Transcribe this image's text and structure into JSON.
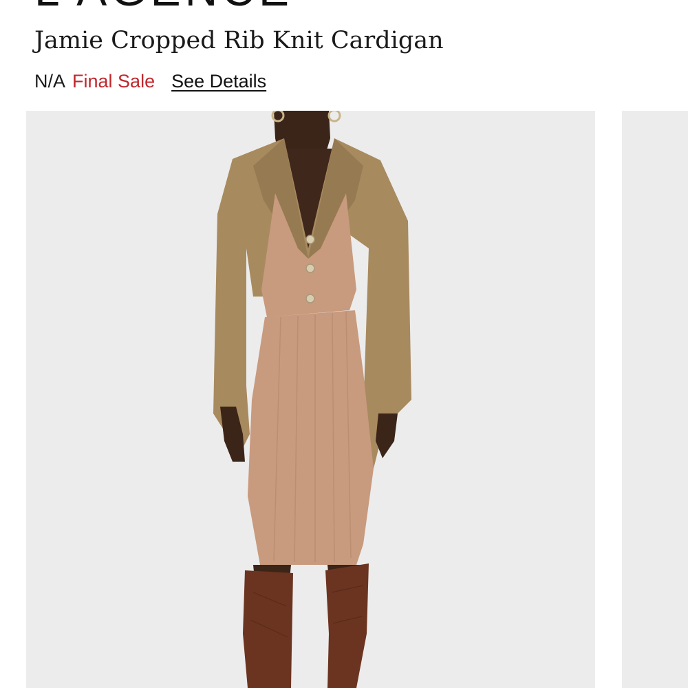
{
  "brand": {
    "name": "L'AGENCE"
  },
  "product": {
    "title": "Jamie Cropped Rib Knit Cardigan",
    "price": "N/A",
    "sale_label": "Final Sale",
    "details_link": "See Details"
  },
  "gallery": {
    "main_image": "product-photo-model-in-tweed-blazer-and-knit-set",
    "next_image": "product-photo-next"
  },
  "colors": {
    "sale": "#c1272d",
    "background": "#ffffff",
    "image_bg": "#ececec",
    "blazer": "#a88a5f",
    "knit": "#c89a7e",
    "boots": "#6b3420",
    "skin": "#3b2418"
  }
}
